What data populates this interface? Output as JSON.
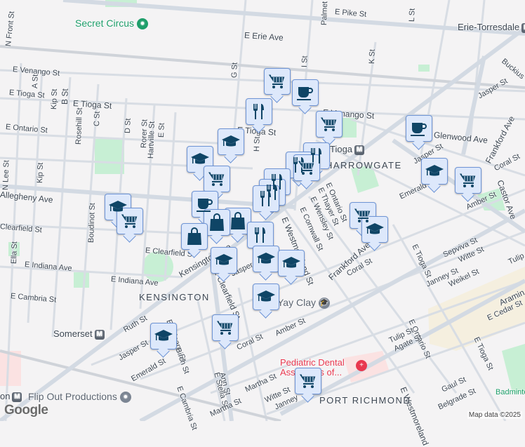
{
  "streets": {
    "erie_ave": "E Erie Ave",
    "erie_ave_right": "rie Ave",
    "front_st": "N Front St",
    "g_st": "G St",
    "i_st": "I St",
    "k_st": "K St",
    "l_st": "L St",
    "pike_st": "E Pike St",
    "palmetto": "Palmet",
    "venango_w": "E Venango St",
    "venango_e": "E Venango St",
    "tioga_w1": "E Tioga St",
    "tioga_w2": "E Tioga St",
    "tioga_mid": "E Tioga St",
    "ontario_w": "E Ontario St",
    "a_st": "A St",
    "kip_st": "Kip St",
    "kip_st2": "Kip St",
    "b_st": "B St",
    "rosehill": "Rosehill St",
    "c_st": "C St",
    "d_st": "D St",
    "rorer": "Rorer St",
    "hartville": "Hartville St",
    "e_st": "E St",
    "h_st": "H St",
    "lee_st": "N Lee St",
    "allegheny": "Allegheny Ave",
    "clearfield_w": "Clearfield St",
    "boudinot": "Boudinot St",
    "clearfield_e": "E Clearfield St",
    "indiana_w": "E Indiana Ave",
    "indiana_e": "E Indiana Ave",
    "ella": "Ella St",
    "cambria_w": "E Cambria St",
    "kensington_ave": "Kensington Ave",
    "clearfield_diag": "E Clearfield St",
    "jasper_mid": "Jasper",
    "ruth": "Ruth St",
    "orleans": "E Orleans St",
    "birch": "Birch St",
    "jasper_sw": "Jasper St",
    "emerald_sw": "Emerald St",
    "coral_mid": "Coral St",
    "amber_mid": "Amber St",
    "ann": "Ann St",
    "stella": "E Stella St",
    "martha_mid": "Martha St",
    "martha_low": "Martha St",
    "cambria_low": "E Cambria St",
    "westmoreland": "E Westmoreland St",
    "westmoreland_low": "E Westmoreland",
    "cornwall": "E Cornwall St",
    "wensley": "E Wensley St",
    "thayer": "E Thayer St",
    "ontario_mid": "E Ontario St",
    "frankford_mid": "Frankford Ave",
    "frankford_ne": "Frankford Ave",
    "coral_e": "Coral St",
    "coral_ne": "Coral St",
    "tioga_se": "E Tioga St",
    "sepviva": "Sepviva St",
    "witte": "Witte St",
    "janney": "Janney St",
    "weikel": "Weikel St",
    "ontario_se": "E Ontario St",
    "tulip": "Tulip St",
    "agate": "Agate St",
    "cedar": "E Cedar St",
    "tioga_far": "E Tioga St",
    "gaul": "Gaul St",
    "belgrade": "Belgrade St",
    "aramingo": "Aramin",
    "glenwood": "Glenwood Ave",
    "jasper_ne": "Jasper St",
    "jasper_ne2": "Jasper St",
    "emerald_ne": "Emerald",
    "amber_ne": "Amber St",
    "castor": "Castor Ave",
    "buckius": "Buckius",
    "witte_low": "Witte St",
    "janney_low": "Janney",
    "tulip_far": "Tulip"
  },
  "neighborhoods": {
    "harrowgate": "HARROWGATE",
    "kensington": "KENSINGTON",
    "port_richmond": "PORT RICHMOND"
  },
  "transit": {
    "erie_torresdale": "Erie-Torresdale",
    "tioga": "Tioga",
    "somerset": "Somerset",
    "huntingdon": "on",
    "metro_glyph": "M"
  },
  "places": {
    "secret_circus": "Secret Circus",
    "flip_out": "Flip Out Productions",
    "yay_clay": "Yay Clay",
    "pediatric_dental": "Pediatric Dental Associates of...",
    "badminton": "Badminto"
  },
  "colors": {
    "pin_fill": "#dde8fb",
    "pin_border": "#6f95d6",
    "icon": "#0f4566",
    "park": "#c7efd4",
    "medical": "#e8384f",
    "poi_green": "#1e9e6a"
  },
  "marker_types": [
    "shopping-cart",
    "coffee-cup",
    "restaurant",
    "school",
    "shopping-bag"
  ],
  "attribution": "Map data ©2025",
  "logo": "Google"
}
